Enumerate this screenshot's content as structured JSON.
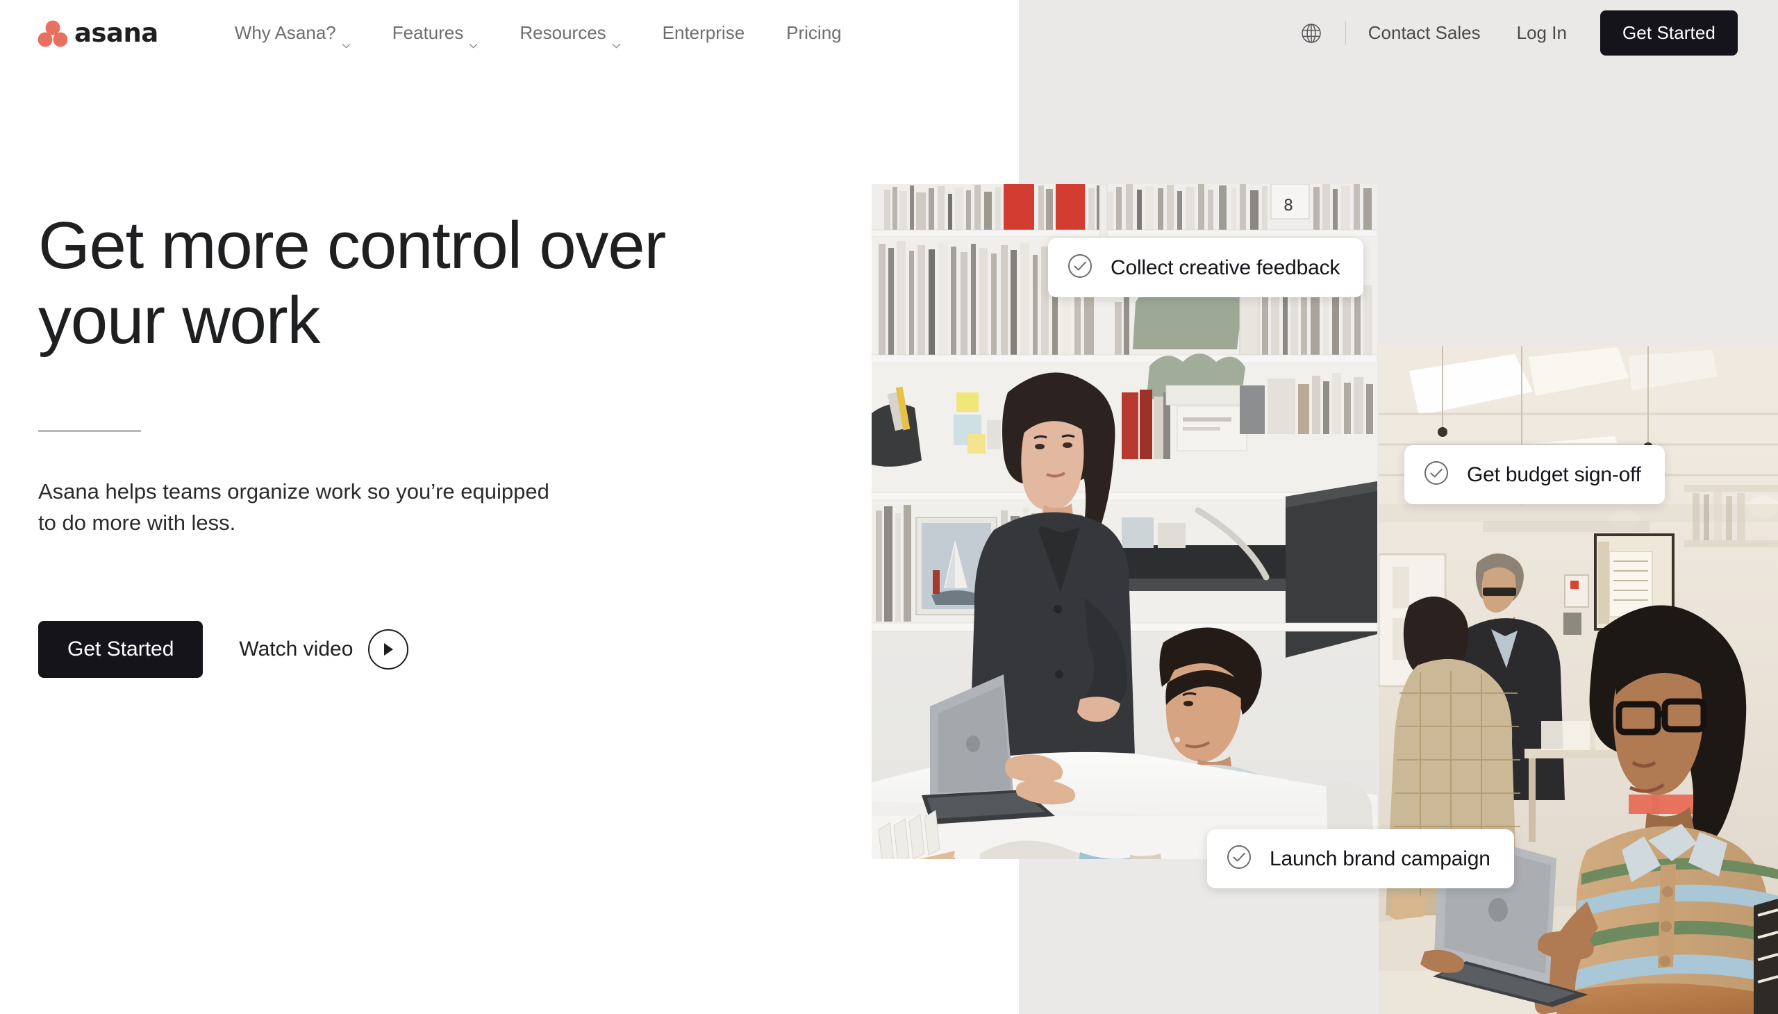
{
  "brand": {
    "name": "asana",
    "logo_icon": "asana-dots-logo",
    "dot_color": "#E8705F",
    "text_color": "#1E1F21"
  },
  "colors": {
    "panel_bg": "#EBE9E7",
    "page_bg": "#FFFFFF",
    "accent_dark": "#14141A",
    "nav_text": "#6D6E6F",
    "body_text": "#2B2B2B",
    "rule": "#B9B9B9"
  },
  "nav": {
    "links": [
      {
        "label": "Why Asana?",
        "has_dropdown": true,
        "icon": "chevron-down-icon"
      },
      {
        "label": "Features",
        "has_dropdown": true,
        "icon": "chevron-down-icon"
      },
      {
        "label": "Resources",
        "has_dropdown": true,
        "icon": "chevron-down-icon"
      },
      {
        "label": "Enterprise",
        "has_dropdown": false,
        "icon": ""
      },
      {
        "label": "Pricing",
        "has_dropdown": false,
        "icon": ""
      }
    ],
    "language_icon": "globe-icon",
    "contact_sales": "Contact Sales",
    "log_in": "Log In",
    "get_started": "Get Started"
  },
  "hero": {
    "title_line1": "Get more control over",
    "title_line2": "your work",
    "subtitle": "Asana helps teams organize work so you’re equipped to do more with less.",
    "primary_cta": "Get Started",
    "secondary_cta": "Watch video",
    "secondary_cta_icon": "play-icon"
  },
  "chips": [
    {
      "label": "Collect creative feedback",
      "icon": "check-circle-icon"
    },
    {
      "label": "Get budget sign-off",
      "icon": "check-circle-icon"
    },
    {
      "label": "Launch brand campaign",
      "icon": "check-circle-icon"
    }
  ],
  "media": [
    {
      "name": "office-studio-collaboration-photo",
      "alt": "Two coworkers reviewing work at a desk in a design studio with shelving"
    },
    {
      "name": "office-woman-laptop-photo",
      "alt": "Woman in striped polo holding a laptop walking through an open office"
    }
  ]
}
